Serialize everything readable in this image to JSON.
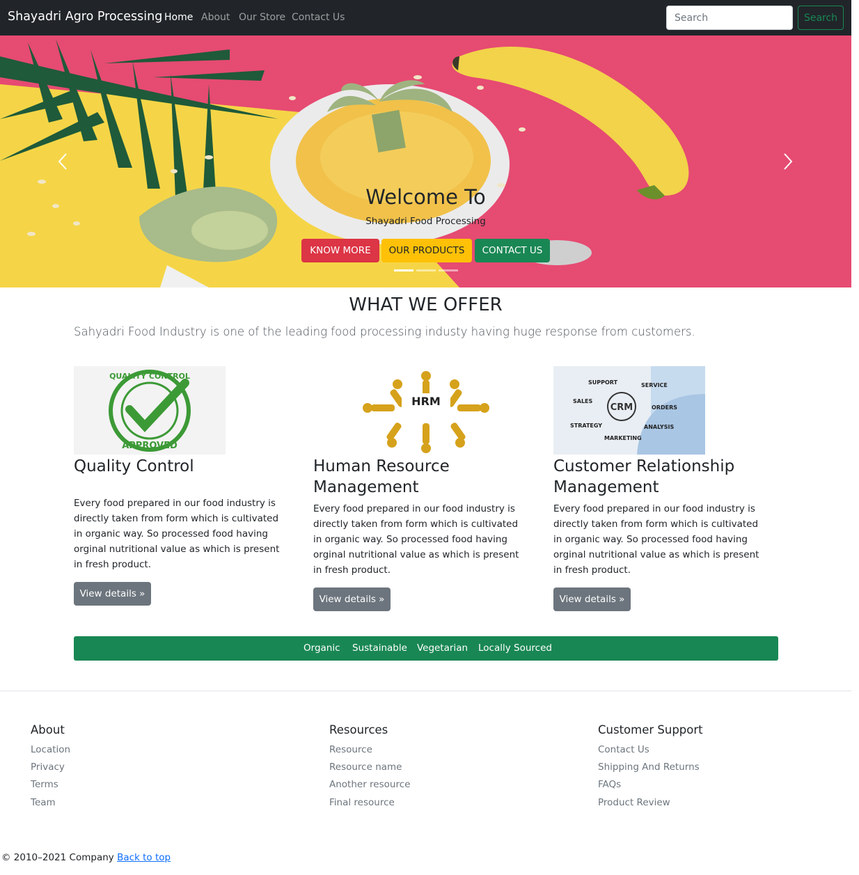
{
  "navbar": {
    "brand": "Shayadri Agro Processing",
    "links": [
      "Home",
      "About",
      "Our Store",
      "Contact Us"
    ],
    "search_placeholder": "Search",
    "search_button": "Search"
  },
  "hero": {
    "title": "Welcome To",
    "subtitle": "Shayadri Food Processing",
    "buttons": [
      "KNOW MORE",
      "OUR PRODUCTS",
      "CONTACT US"
    ],
    "active_slide": 1,
    "slide_count": 3
  },
  "offer": {
    "title": "WHAT WE OFFER",
    "lead": "Sahyadri Food Industry is one of the leading food processing industy having huge response from customers.",
    "features": [
      {
        "title": "Quality Control",
        "image_text": [
          "QUALITY CONTROL",
          "APPROVED"
        ],
        "text": "Every food prepared in our food industry is directly taken from form which is cultivated in organic way. So processed food having orginal nutritional value as which is present in fresh product.",
        "button": "View details »"
      },
      {
        "title": "Human Resource Management",
        "image_text": [
          "HRM"
        ],
        "text": "Every food prepared in our food industry is directly taken from form which is cultivated in organic way. So processed food having orginal nutritional value as which is present in fresh product.",
        "button": "View details »"
      },
      {
        "title": "Customer Relationship Management",
        "image_text": [
          "CRM",
          "SUPPORT",
          "SERVICE",
          "SALES",
          "ORDERS",
          "STRATEGY",
          "ANALYSIS",
          "MARKETING"
        ],
        "text": "Every food prepared in our food industry is directly taken from form which is cultivated in organic way. So processed food having orginal nutritional value as which is present in fresh product.",
        "button": "View details »"
      }
    ],
    "tags": [
      "Organic",
      "Sustainable",
      "Vegetarian",
      "Locally Sourced"
    ]
  },
  "footer": {
    "columns": [
      {
        "heading": "About",
        "links": [
          "Location",
          "Privacy",
          "Terms",
          "Team"
        ]
      },
      {
        "heading": "Resources",
        "links": [
          "Resource",
          "Resource name",
          "Another resource",
          "Final resource"
        ]
      },
      {
        "heading": "Customer Support",
        "links": [
          "Contact Us",
          "Shipping And Returns",
          "FAQs",
          "Product Review"
        ]
      }
    ],
    "copyright": "© 2010–2021 Company",
    "back_to_top": "Back to top"
  },
  "colors": {
    "navbar": "#212529",
    "hero_pink": "#e64b72",
    "hero_yellow": "#f5d547",
    "danger": "#dc3545",
    "warning": "#ffc107",
    "success": "#198754",
    "secondary": "#6c757d"
  },
  "icons": [
    "chevron-left-icon",
    "chevron-right-icon",
    "quality-approved-stamp",
    "hrm-figures",
    "crm-diagram"
  ]
}
